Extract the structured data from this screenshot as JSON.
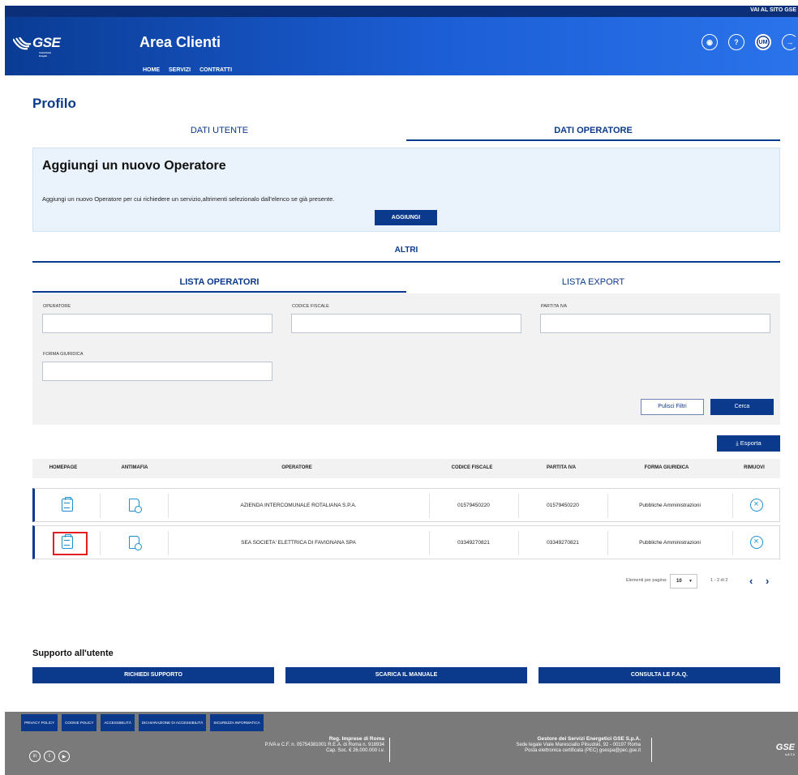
{
  "header": {
    "site_link": "VAI AL SITO GSE",
    "logo": "GSE",
    "logo_sub": "Gestore Servizi Energetici",
    "app_title": "Area Clienti",
    "nav": [
      "HOME",
      "SERVIZI",
      "CONTRATTI"
    ],
    "avatar": "UM",
    "icons": [
      "notifications-icon",
      "help-icon",
      "avatar",
      "logout-icon"
    ]
  },
  "page": {
    "title": "Profilo",
    "tabs": [
      "DATI UTENTE",
      "DATI OPERATORE"
    ],
    "active_tab": "DATI OPERATORE"
  },
  "add_operator": {
    "title": "Aggiungi un nuovo Operatore",
    "description": "Aggiungi un nuovo Operatore per cui richiedere un servizio,altrimenti selezionalo dall'elenco se già presente.",
    "button": "AGGIUNGI"
  },
  "altri": "ALTRI",
  "sub_tabs": [
    "LISTA OPERATORI",
    "LISTA EXPORT"
  ],
  "filters": {
    "operatore": "OPERATORE",
    "codice_fiscale": "CODICE FISCALE",
    "partita_iva": "PARTITA IVA",
    "forma_giuridica": "FORMA GIURIDICA",
    "clear_button": "Pulisci Filtri",
    "search_button": "Cerca"
  },
  "export_button": "Esporta",
  "table": {
    "columns": [
      "HOMEPAGE",
      "ANTIMAFIA",
      "OPERATORE",
      "CODICE FISCALE",
      "PARTITA IVA",
      "FORMA GIURIDICA",
      "RIMUOVI"
    ],
    "rows": [
      {
        "operatore": "AZIENDA INTERCOMUNALE ROTALIANA S.P.A.",
        "codice_fiscale": "01579450220",
        "partita_iva": "01579450220",
        "forma_giuridica": "Pubbliche Amministrazioni"
      },
      {
        "operatore": "SEA SOCIETA' ELETTRICA DI FAVIGNANA SPA",
        "codice_fiscale": "03349270821",
        "partita_iva": "03349270821",
        "forma_giuridica": "Pubbliche Amministrazioni"
      }
    ]
  },
  "pagination": {
    "per_page_label": "Elementi per pagina:",
    "per_page": "10",
    "range": "1 - 2 di 2"
  },
  "support": {
    "title": "Supporto all'utente",
    "buttons": [
      "RICHIEDI SUPPORTO",
      "SCARICA IL MANUALE",
      "CONSULTA LE F.A.Q."
    ]
  },
  "footer": {
    "links": [
      "PRIVACY POLICY",
      "COOKIE POLICY",
      "ACCESSIBILITÀ",
      "DICHIARAZIONE DI ACCESSIBILITÀ",
      "SICUREZZA INFORMATICA"
    ],
    "reg_title": "Reg. Imprese di Roma",
    "reg_line1": "P.IVA e C.F. n. 05754381001 R.E.A. di Roma n. 918934",
    "reg_line2": "Cap. Soc. € 26.000.000 i.v.",
    "company_title": "Gestore dei Servizi Energetici GSE S.p.A.",
    "company_line1": "Sede legale Viale Maresciallo Pilsudski, 92 - 00197 Roma",
    "company_line2": "Posta elettronica certificata (PEC) gsespa@pec.gse.it",
    "logo": "GSE",
    "version": "v.2.7.1"
  },
  "colors": {
    "primary": "#0b3a8c",
    "accent": "#1c8fd0",
    "highlight": "#e02020"
  }
}
